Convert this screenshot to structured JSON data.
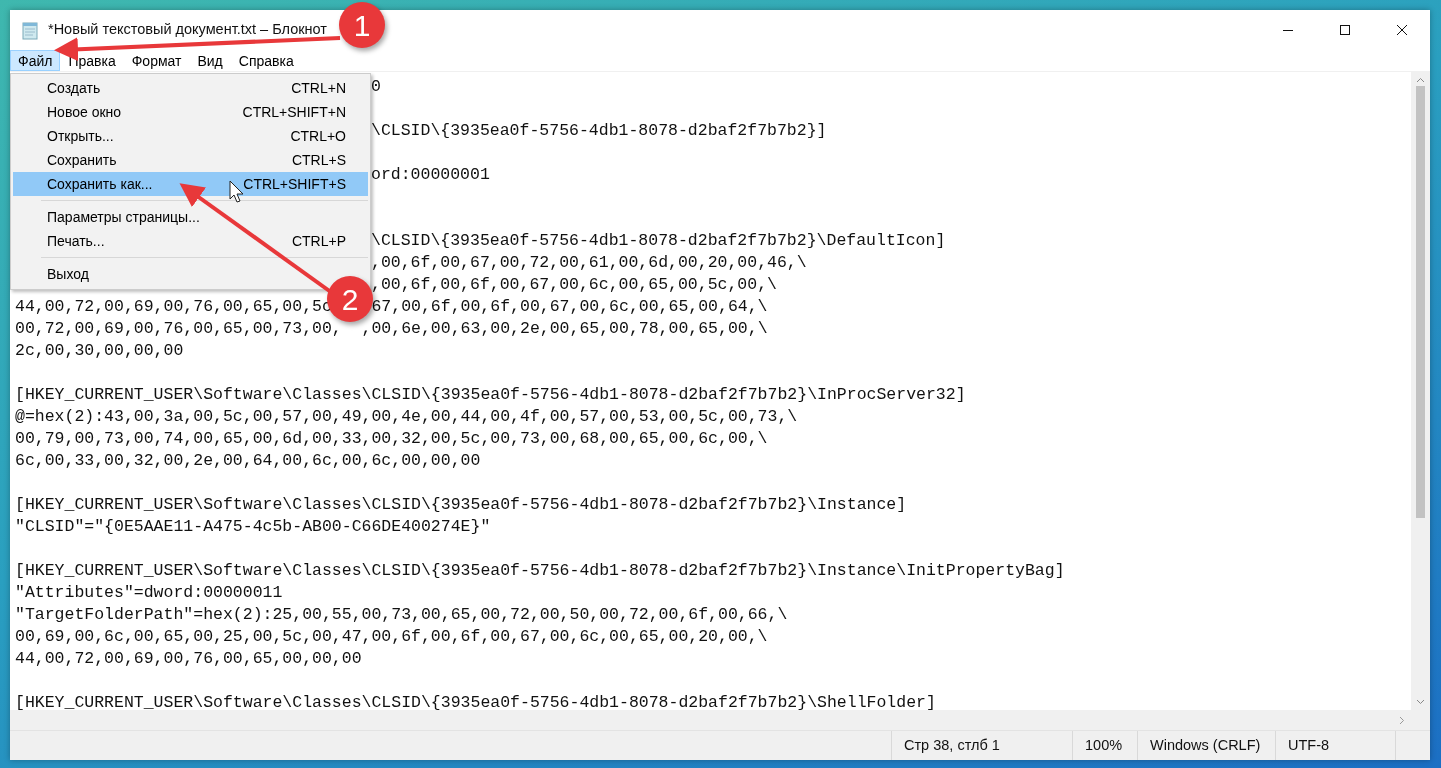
{
  "window": {
    "title": "*Новый текстовый документ.txt – Блокнот"
  },
  "menu_bar": [
    {
      "label": "Файл",
      "selected": true
    },
    {
      "label": "Правка",
      "selected": false
    },
    {
      "label": "Формат",
      "selected": false
    },
    {
      "label": "Вид",
      "selected": false
    },
    {
      "label": "Справка",
      "selected": false
    }
  ],
  "file_menu": {
    "groups": [
      [
        {
          "label": "Создать",
          "shortcut": "CTRL+N",
          "selected": false
        },
        {
          "label": "Новое окно",
          "shortcut": "CTRL+SHIFT+N",
          "selected": false
        },
        {
          "label": "Открыть...",
          "shortcut": "CTRL+O",
          "selected": false
        },
        {
          "label": "Сохранить",
          "shortcut": "CTRL+S",
          "selected": false
        },
        {
          "label": "Сохранить как...",
          "shortcut": "CTRL+SHIFT+S",
          "selected": true
        }
      ],
      [
        {
          "label": "Параметры страницы...",
          "selected": false
        },
        {
          "label": "Печать...",
          "shortcut": "CTRL+P",
          "selected": false
        }
      ],
      [
        {
          "label": "Выход",
          "selected": false
        }
      ]
    ]
  },
  "editor": {
    "lines": [
      {
        "kind": "partial",
        "text": "0"
      },
      {
        "kind": "blank"
      },
      {
        "kind": "partial",
        "text": "\\CLSID\\{3935ea0f-5756-4db1-8078-d2baf2f7b7b2}]"
      },
      {
        "kind": "blank"
      },
      {
        "kind": "partial",
        "text": "ord:00000001"
      },
      {
        "kind": "blank"
      },
      {
        "kind": "blank"
      },
      {
        "kind": "partial",
        "text": "\\CLSID\\{3935ea0f-5756-4db1-8078-d2baf2f7b7b2}\\DefaultIcon]"
      },
      {
        "kind": "partial",
        "text": ",00,6f,00,67,00,72,00,61,00,6d,00,20,00,46,\\"
      },
      {
        "kind": "partial",
        "text": ",00,6f,00,6f,00,67,00,6c,00,65,00,5c,00,\\"
      },
      {
        "kind": "covered",
        "parts": [
          "44,00,72,00,69,00,76,00,65,00,5c",
          "67,00,6f,00,6f,00,67,00,6c,00,65,00,64,\\"
        ]
      },
      {
        "kind": "covered",
        "parts": [
          "00,72,00,69,00,76,00,65,00,73,00,",
          ",00,6e,00,63,00,2e,00,65,00,78,00,65,00,\\"
        ]
      },
      {
        "kind": "full",
        "text": "2c,00,30,00,00,00"
      },
      {
        "kind": "blank"
      },
      {
        "kind": "full",
        "text": "[HKEY_CURRENT_USER\\Software\\Classes\\CLSID\\{3935ea0f-5756-4db1-8078-d2baf2f7b7b2}\\InProcServer32]"
      },
      {
        "kind": "full",
        "text": "@=hex(2):43,00,3a,00,5c,00,57,00,49,00,4e,00,44,00,4f,00,57,00,53,00,5c,00,73,\\"
      },
      {
        "kind": "full",
        "text": "00,79,00,73,00,74,00,65,00,6d,00,33,00,32,00,5c,00,73,00,68,00,65,00,6c,00,\\"
      },
      {
        "kind": "full",
        "text": "6c,00,33,00,32,00,2e,00,64,00,6c,00,6c,00,00,00"
      },
      {
        "kind": "blank"
      },
      {
        "kind": "full",
        "text": "[HKEY_CURRENT_USER\\Software\\Classes\\CLSID\\{3935ea0f-5756-4db1-8078-d2baf2f7b7b2}\\Instance]"
      },
      {
        "kind": "full",
        "text": "\"CLSID\"=\"{0E5AAE11-A475-4c5b-AB00-C66DE400274E}\""
      },
      {
        "kind": "blank"
      },
      {
        "kind": "full",
        "text": "[HKEY_CURRENT_USER\\Software\\Classes\\CLSID\\{3935ea0f-5756-4db1-8078-d2baf2f7b7b2}\\Instance\\InitPropertyBag]"
      },
      {
        "kind": "full",
        "text": "\"Attributes\"=dword:00000011"
      },
      {
        "kind": "full",
        "text": "\"TargetFolderPath\"=hex(2):25,00,55,00,73,00,65,00,72,00,50,00,72,00,6f,00,66,\\"
      },
      {
        "kind": "full",
        "text": "00,69,00,6c,00,65,00,25,00,5c,00,47,00,6f,00,6f,00,67,00,6c,00,65,00,20,00,\\"
      },
      {
        "kind": "full",
        "text": "44,00,72,00,69,00,76,00,65,00,00,00"
      },
      {
        "kind": "blank"
      },
      {
        "kind": "full",
        "text": "[HKEY_CURRENT_USER\\Software\\Classes\\CLSID\\{3935ea0f-5756-4db1-8078-d2baf2f7b7b2}\\ShellFolder]"
      }
    ]
  },
  "status_bar": [
    "Стр 38, стлб 1",
    "100%",
    "Windows (CRLF)",
    "UTF-8"
  ],
  "annotations": [
    {
      "label": "1"
    },
    {
      "label": "2"
    }
  ]
}
